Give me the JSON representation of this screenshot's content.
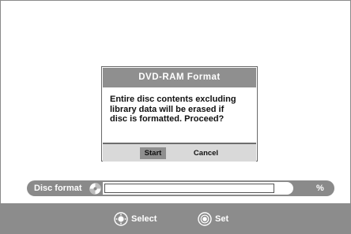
{
  "dialog": {
    "title": "DVD-RAM Format",
    "message_lines": [
      "Entire disc contents excluding",
      "library data will be erased if",
      "disc is formatted. Proceed?"
    ],
    "buttons": {
      "start_label": "Start",
      "cancel_label": "Cancel"
    }
  },
  "progress": {
    "label": "Disc format",
    "percent_text": "%",
    "value_fraction": 0.0,
    "icon": "disc-icon"
  },
  "hints": {
    "select_label": "Select",
    "set_label": "Set",
    "select_icon": "dpad-icon",
    "set_icon": "enter-icon"
  },
  "colors": {
    "bar_gray": "#8c8c8c",
    "selected_button": "#8f8f8f",
    "button_bar": "#d9d9d9"
  }
}
